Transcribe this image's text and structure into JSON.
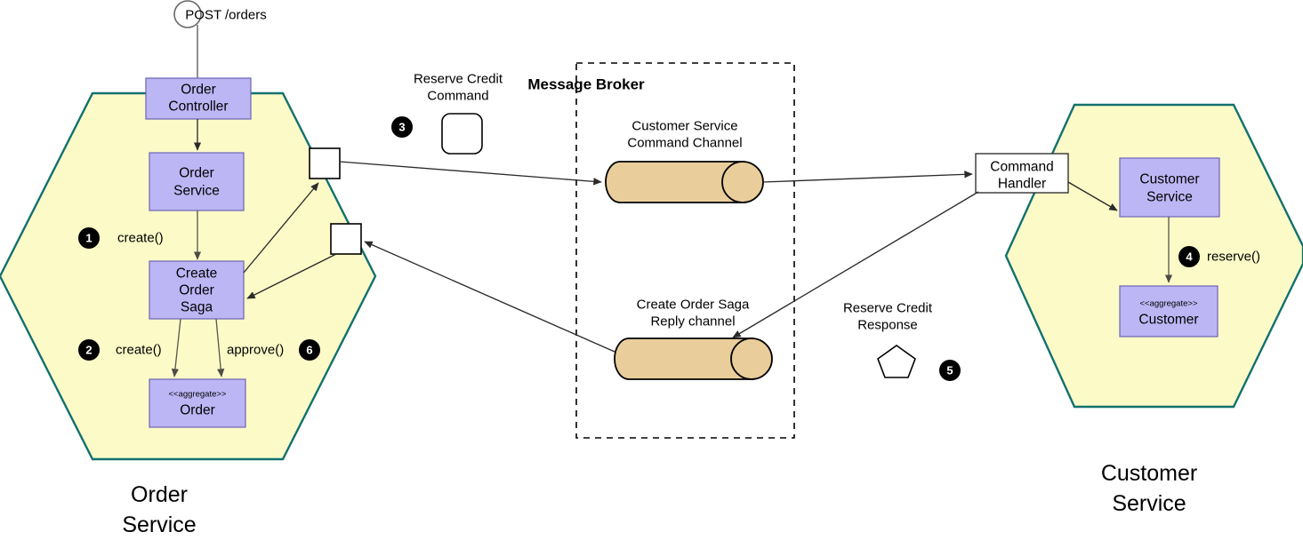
{
  "diagram": {
    "title": "Create Order Saga choreography",
    "colors": {
      "hexagon_fill": "#fcfbc8",
      "hexagon_stroke": "#12716f",
      "component_fill": "#bdb6f5",
      "component_stroke": "#6c63b5",
      "channel_fill": "#e9cd9b",
      "badge_fill": "#000000",
      "edge_stroke": "#2b2b2b",
      "background": "#ffffff"
    }
  },
  "entrypoint": {
    "label": "POST /orders",
    "marker": "start-circle"
  },
  "order_service": {
    "service_label_line1": "Order",
    "service_label_line2": "Service",
    "nodes": {
      "controller": {
        "line1": "Order",
        "line2": "Controller"
      },
      "service": {
        "line1": "Order",
        "line2": "Service"
      },
      "saga": {
        "line1": "Create",
        "line2": "Order",
        "line3": "Saga"
      },
      "aggregate": {
        "stereotype": "<<aggregate>>",
        "name": "Order"
      }
    },
    "annotations": [
      {
        "badge": "1",
        "label": "create()"
      },
      {
        "badge": "2",
        "label": "create()"
      },
      {
        "badge": "6",
        "label": "approve()"
      }
    ]
  },
  "messages": {
    "reserve_credit_command": {
      "line1": "Reserve Credit",
      "line2": "Command",
      "badge": "3",
      "shape": "rounded-rect"
    },
    "reserve_credit_response": {
      "line1": "Reserve Credit",
      "line2": "Response",
      "badge": "5",
      "shape": "pentagon"
    }
  },
  "message_broker": {
    "title": "Message Broker",
    "channels": [
      {
        "line1": "Customer Service",
        "line2": "Command Channel",
        "shape": "cylinder"
      },
      {
        "line1": "Create Order Saga",
        "line2": "Reply channel",
        "shape": "cylinder"
      }
    ]
  },
  "command_handler": {
    "line1": "Command",
    "line2": "Handler"
  },
  "customer_service": {
    "service_label_line1": "Customer",
    "service_label_line2": "Service",
    "nodes": {
      "service": {
        "line1": "Customer",
        "line2": "Service"
      },
      "aggregate": {
        "stereotype": "<<aggregate>>",
        "name": "Customer"
      }
    },
    "annotations": [
      {
        "badge": "4",
        "label": "reserve()"
      }
    ]
  }
}
